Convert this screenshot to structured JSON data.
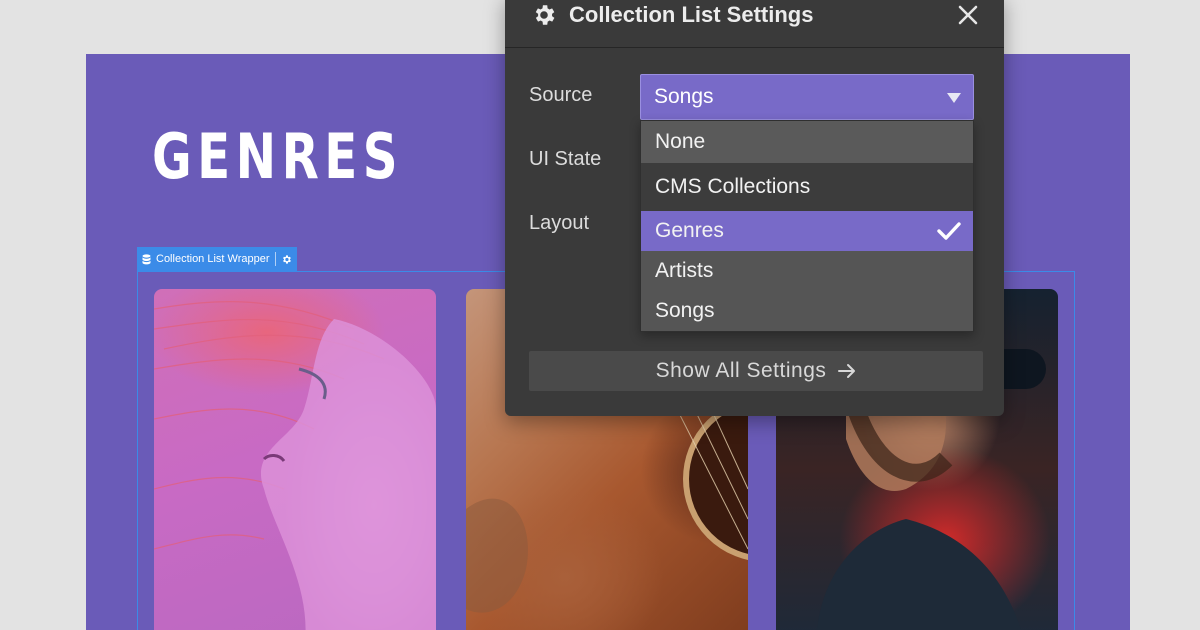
{
  "page": {
    "heading": "GENRES",
    "wrapper_label": "Collection List Wrapper"
  },
  "cards": [
    {
      "subject": "woman with pink hair"
    },
    {
      "subject": "acoustic guitar"
    },
    {
      "subject": "singer with microphone"
    }
  ],
  "panel": {
    "title": "Collection List Settings",
    "labels": {
      "source": "Source",
      "ui_state": "UI State",
      "layout": "Layout"
    },
    "source_value": "Songs",
    "options": {
      "none": "None",
      "group_header": "CMS Collections",
      "items": [
        "Genres",
        "Artists",
        "Songs"
      ],
      "checked": "Genres"
    },
    "show_all_label": "Show All Settings"
  },
  "colors": {
    "canvas_purple": "#6a5bb8",
    "accent_purple": "#786ac8",
    "selection_blue": "#3b8be8",
    "panel_bg": "#3a3a3a"
  },
  "icons": [
    "gear-icon",
    "close-icon",
    "caret-down-icon",
    "checkmark-icon",
    "arrow-right-icon",
    "database-icon",
    "settings-gear-small-icon"
  ]
}
